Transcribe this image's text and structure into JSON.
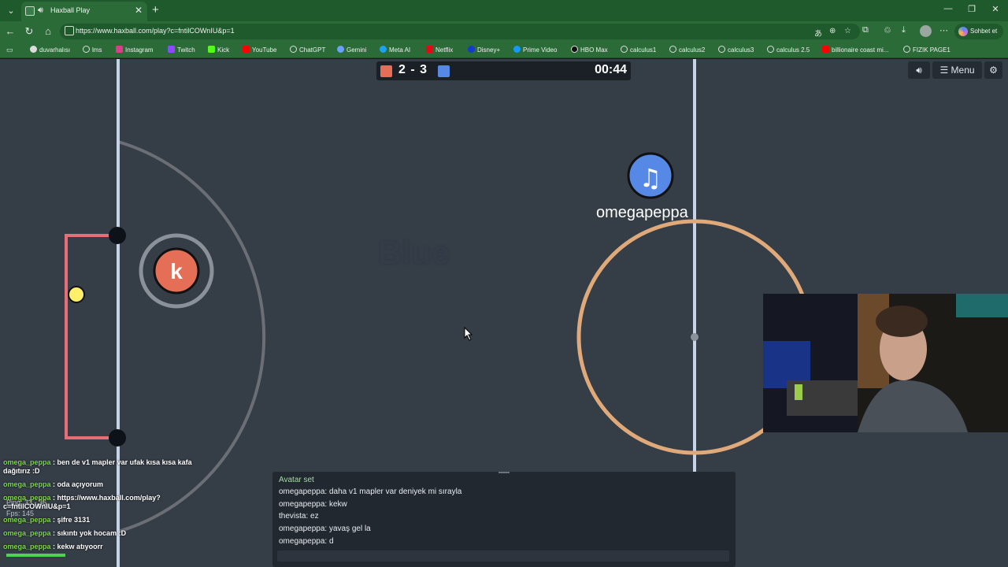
{
  "browser": {
    "tab_title": "Haxball Play",
    "url": "https://www.haxball.com/play?c=fntilCOWnIU&p=1",
    "chat_button": "Sohbet et",
    "bookmarks": [
      "duvarhalısı",
      "lms",
      "Instagram",
      "Twitch",
      "Kick",
      "YouTube",
      "ChatGPT",
      "Gemini",
      "Meta AI",
      "Netflix",
      "Disney+",
      "Prime Video",
      "HBO Max",
      "calculus1",
      "calculus2",
      "calculus3",
      "calculus 2.5",
      "billionaire coast mi...",
      "FIZIK PAGE1"
    ]
  },
  "game": {
    "score": "2 - 3",
    "timer": "00:44",
    "menu_label": "Menu",
    "red_player_avatar": "k",
    "blue_player_name": "omegapeppa",
    "blue_player_icon": "music-note",
    "team_text": "Blue",
    "colors": {
      "red": "#e56e56",
      "blue": "#5689e5",
      "ball": "#ffef6a",
      "field": "#353d47",
      "kickoff": "#e0a97a"
    }
  },
  "stats": {
    "ping": "Ping: 33 - 36",
    "fps": "Fps: 145"
  },
  "overlay_chat": [
    {
      "nick": "omega_peppa",
      "text": ": ben de v1 mapler var ufak kısa kısa kafa dağıtırız :D"
    },
    {
      "nick": "omega_peppa",
      "text": ": oda açıyorum"
    },
    {
      "nick": "omega_peppa",
      "text": ": https://www.haxball.com/play?c=fntilCOWnIU&p=1"
    },
    {
      "nick": "omega_peppa",
      "text": ": şifre 3131"
    },
    {
      "nick": "omega_peppa",
      "text": ": sıkıntı yok hocam :D"
    },
    {
      "nick": "omega_peppa",
      "text": ": kekw atıyoorr"
    }
  ],
  "game_chat": {
    "notice": "Avatar set",
    "lines": [
      "omegapeppa: daha v1 mapler var deniyek mi sırayla",
      "omegapeppa: kekw",
      "thevista: ez",
      "omegapeppa: yavaş gel la",
      "omegapeppa: d"
    ]
  }
}
